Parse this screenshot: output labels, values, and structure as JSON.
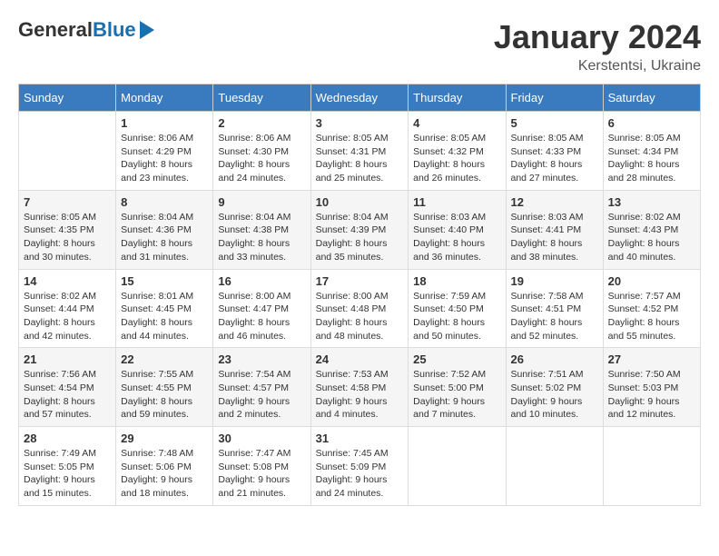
{
  "header": {
    "logo_general": "General",
    "logo_blue": "Blue",
    "month_year": "January 2024",
    "location": "Kerstentsi, Ukraine"
  },
  "days_of_week": [
    "Sunday",
    "Monday",
    "Tuesday",
    "Wednesday",
    "Thursday",
    "Friday",
    "Saturday"
  ],
  "weeks": [
    [
      {
        "day": "",
        "info": ""
      },
      {
        "day": "1",
        "info": "Sunrise: 8:06 AM\nSunset: 4:29 PM\nDaylight: 8 hours\nand 23 minutes."
      },
      {
        "day": "2",
        "info": "Sunrise: 8:06 AM\nSunset: 4:30 PM\nDaylight: 8 hours\nand 24 minutes."
      },
      {
        "day": "3",
        "info": "Sunrise: 8:05 AM\nSunset: 4:31 PM\nDaylight: 8 hours\nand 25 minutes."
      },
      {
        "day": "4",
        "info": "Sunrise: 8:05 AM\nSunset: 4:32 PM\nDaylight: 8 hours\nand 26 minutes."
      },
      {
        "day": "5",
        "info": "Sunrise: 8:05 AM\nSunset: 4:33 PM\nDaylight: 8 hours\nand 27 minutes."
      },
      {
        "day": "6",
        "info": "Sunrise: 8:05 AM\nSunset: 4:34 PM\nDaylight: 8 hours\nand 28 minutes."
      }
    ],
    [
      {
        "day": "7",
        "info": "Sunrise: 8:05 AM\nSunset: 4:35 PM\nDaylight: 8 hours\nand 30 minutes."
      },
      {
        "day": "8",
        "info": "Sunrise: 8:04 AM\nSunset: 4:36 PM\nDaylight: 8 hours\nand 31 minutes."
      },
      {
        "day": "9",
        "info": "Sunrise: 8:04 AM\nSunset: 4:38 PM\nDaylight: 8 hours\nand 33 minutes."
      },
      {
        "day": "10",
        "info": "Sunrise: 8:04 AM\nSunset: 4:39 PM\nDaylight: 8 hours\nand 35 minutes."
      },
      {
        "day": "11",
        "info": "Sunrise: 8:03 AM\nSunset: 4:40 PM\nDaylight: 8 hours\nand 36 minutes."
      },
      {
        "day": "12",
        "info": "Sunrise: 8:03 AM\nSunset: 4:41 PM\nDaylight: 8 hours\nand 38 minutes."
      },
      {
        "day": "13",
        "info": "Sunrise: 8:02 AM\nSunset: 4:43 PM\nDaylight: 8 hours\nand 40 minutes."
      }
    ],
    [
      {
        "day": "14",
        "info": "Sunrise: 8:02 AM\nSunset: 4:44 PM\nDaylight: 8 hours\nand 42 minutes."
      },
      {
        "day": "15",
        "info": "Sunrise: 8:01 AM\nSunset: 4:45 PM\nDaylight: 8 hours\nand 44 minutes."
      },
      {
        "day": "16",
        "info": "Sunrise: 8:00 AM\nSunset: 4:47 PM\nDaylight: 8 hours\nand 46 minutes."
      },
      {
        "day": "17",
        "info": "Sunrise: 8:00 AM\nSunset: 4:48 PM\nDaylight: 8 hours\nand 48 minutes."
      },
      {
        "day": "18",
        "info": "Sunrise: 7:59 AM\nSunset: 4:50 PM\nDaylight: 8 hours\nand 50 minutes."
      },
      {
        "day": "19",
        "info": "Sunrise: 7:58 AM\nSunset: 4:51 PM\nDaylight: 8 hours\nand 52 minutes."
      },
      {
        "day": "20",
        "info": "Sunrise: 7:57 AM\nSunset: 4:52 PM\nDaylight: 8 hours\nand 55 minutes."
      }
    ],
    [
      {
        "day": "21",
        "info": "Sunrise: 7:56 AM\nSunset: 4:54 PM\nDaylight: 8 hours\nand 57 minutes."
      },
      {
        "day": "22",
        "info": "Sunrise: 7:55 AM\nSunset: 4:55 PM\nDaylight: 8 hours\nand 59 minutes."
      },
      {
        "day": "23",
        "info": "Sunrise: 7:54 AM\nSunset: 4:57 PM\nDaylight: 9 hours\nand 2 minutes."
      },
      {
        "day": "24",
        "info": "Sunrise: 7:53 AM\nSunset: 4:58 PM\nDaylight: 9 hours\nand 4 minutes."
      },
      {
        "day": "25",
        "info": "Sunrise: 7:52 AM\nSunset: 5:00 PM\nDaylight: 9 hours\nand 7 minutes."
      },
      {
        "day": "26",
        "info": "Sunrise: 7:51 AM\nSunset: 5:02 PM\nDaylight: 9 hours\nand 10 minutes."
      },
      {
        "day": "27",
        "info": "Sunrise: 7:50 AM\nSunset: 5:03 PM\nDaylight: 9 hours\nand 12 minutes."
      }
    ],
    [
      {
        "day": "28",
        "info": "Sunrise: 7:49 AM\nSunset: 5:05 PM\nDaylight: 9 hours\nand 15 minutes."
      },
      {
        "day": "29",
        "info": "Sunrise: 7:48 AM\nSunset: 5:06 PM\nDaylight: 9 hours\nand 18 minutes."
      },
      {
        "day": "30",
        "info": "Sunrise: 7:47 AM\nSunset: 5:08 PM\nDaylight: 9 hours\nand 21 minutes."
      },
      {
        "day": "31",
        "info": "Sunrise: 7:45 AM\nSunset: 5:09 PM\nDaylight: 9 hours\nand 24 minutes."
      },
      {
        "day": "",
        "info": ""
      },
      {
        "day": "",
        "info": ""
      },
      {
        "day": "",
        "info": ""
      }
    ]
  ]
}
